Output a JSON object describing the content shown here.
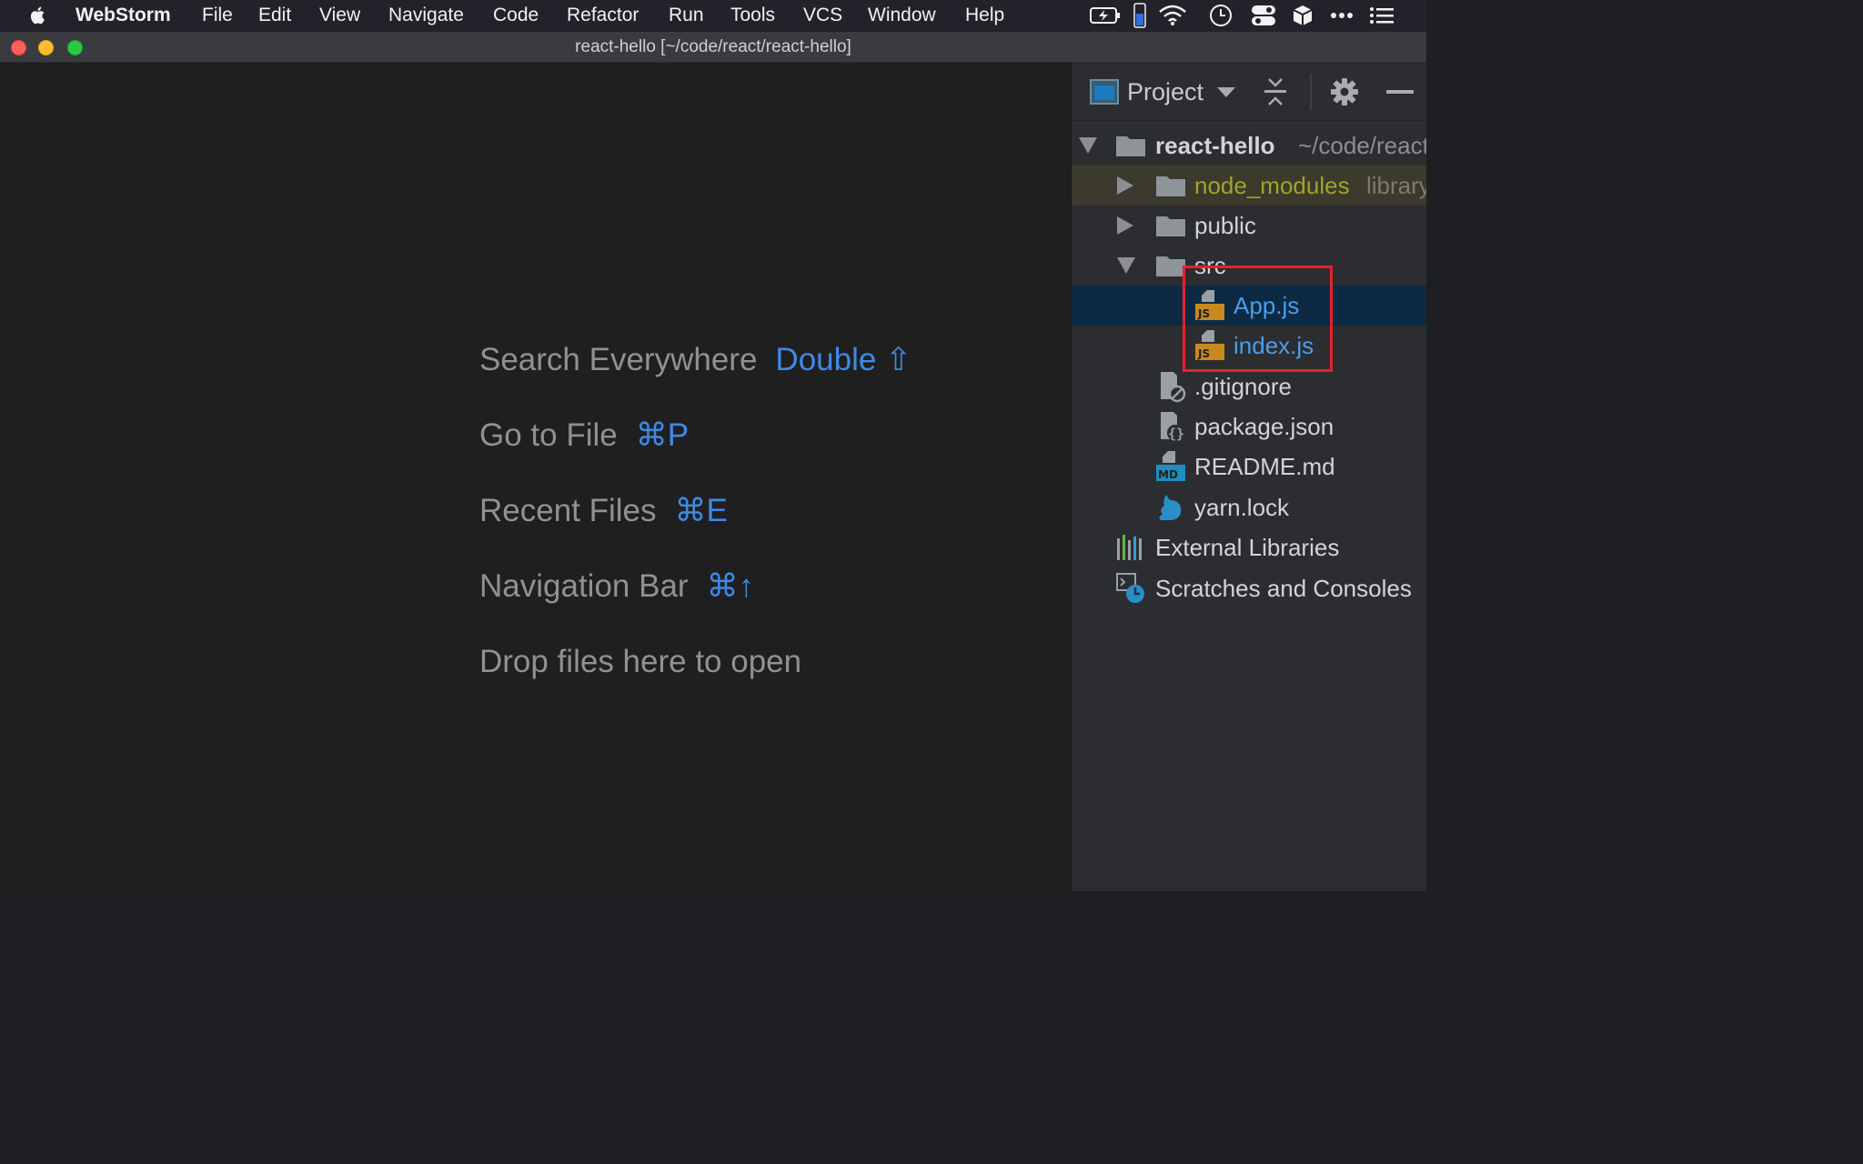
{
  "menubar": {
    "app_name": "WebStorm",
    "items": [
      "File",
      "Edit",
      "View",
      "Navigate",
      "Code",
      "Refactor",
      "Run",
      "Tools",
      "VCS",
      "Window",
      "Help"
    ]
  },
  "window": {
    "title": "react-hello [~/code/react/react-hello]"
  },
  "editor": {
    "hints": [
      {
        "label": "Search Everywhere",
        "shortcut": "Double ⇧"
      },
      {
        "label": "Go to File",
        "shortcut": "⌘P"
      },
      {
        "label": "Recent Files",
        "shortcut": "⌘E"
      },
      {
        "label": "Navigation Bar",
        "shortcut": "⌘↑"
      },
      {
        "label": "Drop files here to open",
        "shortcut": ""
      }
    ]
  },
  "project_panel": {
    "title": "Project",
    "tree": {
      "root": {
        "name": "react-hello",
        "path": "~/code/react"
      },
      "node_modules": {
        "name": "node_modules",
        "hint": "library"
      },
      "public": "public",
      "src": "src",
      "app_js": "App.js",
      "index_js": "index.js",
      "gitignore": ".gitignore",
      "package_json": "package.json",
      "readme": "README.md",
      "yarn_lock": "yarn.lock",
      "external_libraries": "External Libraries",
      "scratches": "Scratches and Consoles"
    }
  },
  "colors": {
    "accent_blue": "#3f89e6",
    "file_blue": "#4b9eea",
    "node_modules_olive": "#a3a32c",
    "selection_bg": "#0d2a45",
    "highlight_red": "#e8202e"
  }
}
